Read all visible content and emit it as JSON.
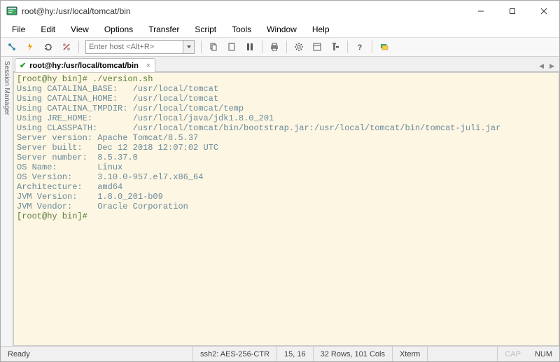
{
  "window": {
    "title": "root@hy:/usr/local/tomcat/bin"
  },
  "menu": {
    "file": "File",
    "edit": "Edit",
    "view": "View",
    "options": "Options",
    "transfer": "Transfer",
    "script": "Script",
    "tools": "Tools",
    "window": "Window",
    "help": "Help"
  },
  "toolbar": {
    "host_placeholder": "Enter host <Alt+R>"
  },
  "sidebar": {
    "label": "Session Manager"
  },
  "tab": {
    "label": "root@hy:/usr/local/tomcat/bin",
    "close": "×"
  },
  "terminal": {
    "lines": [
      {
        "cls": "c-prompt",
        "text": "[root@hy bin]# ./version.sh"
      },
      {
        "cls": "c-out",
        "text": "Using CATALINA_BASE:   /usr/local/tomcat"
      },
      {
        "cls": "c-out",
        "text": "Using CATALINA_HOME:   /usr/local/tomcat"
      },
      {
        "cls": "c-out",
        "text": "Using CATALINA_TMPDIR: /usr/local/tomcat/temp"
      },
      {
        "cls": "c-out",
        "text": "Using JRE_HOME:        /usr/local/java/jdk1.8.0_201"
      },
      {
        "cls": "c-out",
        "text": "Using CLASSPATH:       /usr/local/tomcat/bin/bootstrap.jar:/usr/local/tomcat/bin/tomcat-juli.jar"
      },
      {
        "cls": "c-out",
        "text": "Server version: Apache Tomcat/8.5.37"
      },
      {
        "cls": "c-out",
        "text": "Server built:   Dec 12 2018 12:07:02 UTC"
      },
      {
        "cls": "c-out",
        "text": "Server number:  8.5.37.0"
      },
      {
        "cls": "c-out",
        "text": "OS Name:        Linux"
      },
      {
        "cls": "c-out",
        "text": "OS Version:     3.10.0-957.el7.x86_64"
      },
      {
        "cls": "c-out",
        "text": "Architecture:   amd64"
      },
      {
        "cls": "c-out",
        "text": "JVM Version:    1.8.0_201-b09"
      },
      {
        "cls": "c-out",
        "text": "JVM Vendor:     Oracle Corporation"
      },
      {
        "cls": "c-prompt",
        "text": "[root@hy bin]# "
      }
    ]
  },
  "status": {
    "ready": "Ready",
    "cipher": "ssh2: AES-256-CTR",
    "pos": "15, 16",
    "size": "32 Rows, 101 Cols",
    "term": "Xterm",
    "cap": "CAP",
    "num": "NUM"
  }
}
